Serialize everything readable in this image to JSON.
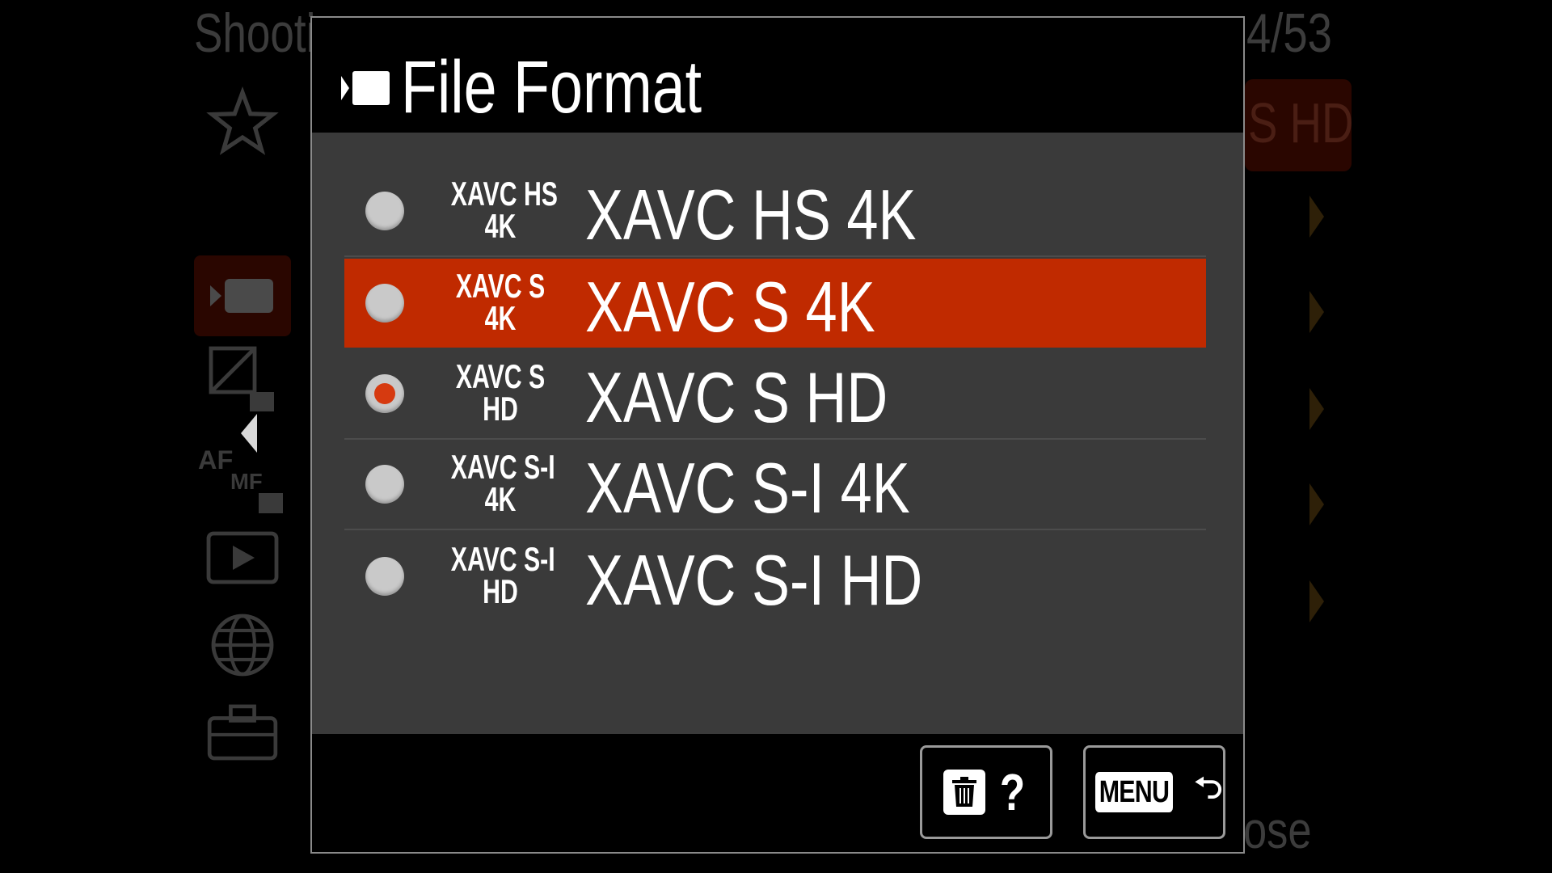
{
  "background_menu": {
    "title": "Shooti",
    "page_indicator": "4/53",
    "current_value": "S HD",
    "close_label": "ose",
    "side_tabs": [
      {
        "icon": "star-icon"
      },
      {
        "icon": "movie-icon"
      },
      {
        "icon": "exposure-color-icon"
      },
      {
        "icon": "af-mf-icon",
        "label": "AF MF"
      },
      {
        "icon": "playback-icon"
      },
      {
        "icon": "network-globe-icon"
      },
      {
        "icon": "toolbox-icon"
      }
    ]
  },
  "dialog": {
    "title": "File Format",
    "title_icon": "movie-icon",
    "options": [
      {
        "badge_top": "XAVC HS",
        "badge_bottom": "4K",
        "label": "XAVC HS 4K",
        "checked": false,
        "highlighted": false
      },
      {
        "badge_top": "XAVC S",
        "badge_bottom": "4K",
        "label": "XAVC S 4K",
        "checked": false,
        "highlighted": true
      },
      {
        "badge_top": "XAVC S",
        "badge_bottom": "HD",
        "label": "XAVC S HD",
        "checked": true,
        "highlighted": false
      },
      {
        "badge_top": "XAVC S-I",
        "badge_bottom": "4K",
        "label": "XAVC S-I 4K",
        "checked": false,
        "highlighted": false
      },
      {
        "badge_top": "XAVC S-I",
        "badge_bottom": "HD",
        "label": "XAVC S-I HD",
        "checked": false,
        "highlighted": false
      }
    ],
    "footer": {
      "help_button": {
        "icon": "trash-icon",
        "text": "?"
      },
      "back_button": {
        "label": "MENU",
        "icon": "return-arrow-icon"
      }
    }
  },
  "colors": {
    "highlight": "#c02a00",
    "radio_selected": "#d63a10",
    "body_background": "#3a3a3a"
  }
}
